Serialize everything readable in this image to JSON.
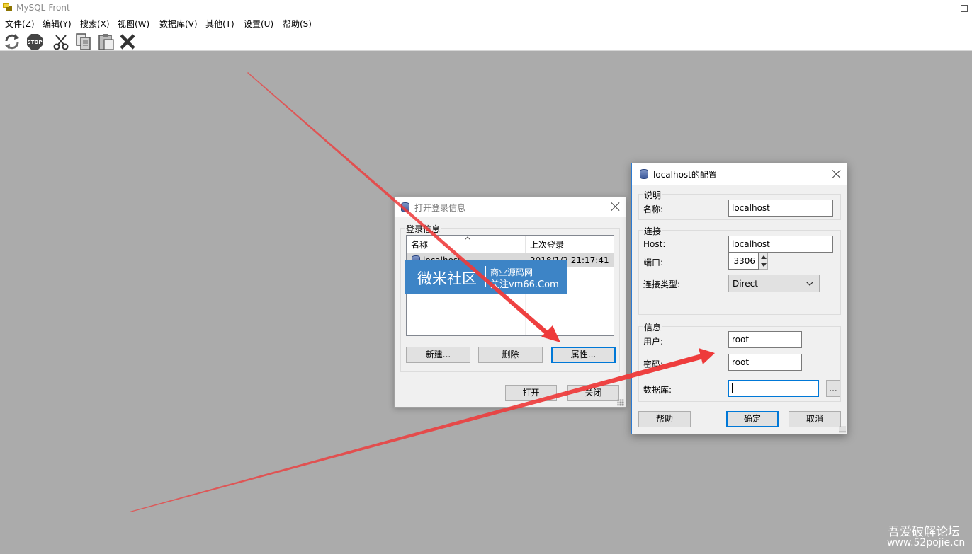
{
  "app": {
    "title": "MySQL-Front"
  },
  "menu": [
    "文件(Z)",
    "编辑(Y)",
    "搜索(X)",
    "视图(W)",
    "数据库(V)",
    "其他(T)",
    "设置(U)",
    "帮助(S)"
  ],
  "toolbar": {
    "icons": [
      "refresh-icon",
      "stop-icon",
      "cut-icon",
      "copy-icon",
      "paste-icon",
      "delete-icon"
    ],
    "stop_label": "STOP"
  },
  "login_dialog": {
    "title": "打开登录信息",
    "group_label": "登录信息",
    "columns": [
      "名称",
      "上次登录"
    ],
    "rows": [
      {
        "name": "localhost",
        "last_login": "2018/1/2 21:17:41"
      }
    ],
    "buttons": {
      "new": "新建...",
      "delete": "删除",
      "properties": "属性...",
      "open": "打开",
      "close": "关闭"
    }
  },
  "config_dialog": {
    "title": "localhost的配置",
    "desc_group": "说明",
    "name_label": "名称:",
    "name_value": "localhost",
    "conn_group": "连接",
    "host_label": "Host:",
    "host_value": "localhost",
    "port_label": "端口:",
    "port_value": "3306",
    "conn_type_label": "连接类型:",
    "conn_type_value": "Direct",
    "info_group": "信息",
    "user_label": "用户:",
    "user_value": "root",
    "password_label": "密码:",
    "password_value": "root",
    "database_label": "数据库:",
    "database_value": "",
    "browse_label": "...",
    "buttons": {
      "help": "帮助",
      "ok": "确定",
      "cancel": "取消"
    }
  },
  "watermark": {
    "main": "微米社区",
    "line1": "商业源码网",
    "line2": "关注vm66.Com"
  },
  "forum": {
    "name": "吾爱破解论坛",
    "url": "www.52pojie.cn"
  },
  "colors": {
    "background": "#ababab",
    "accent": "#0078d7",
    "arrow": "#ee3a3a",
    "watermark": "#3d84c6"
  }
}
